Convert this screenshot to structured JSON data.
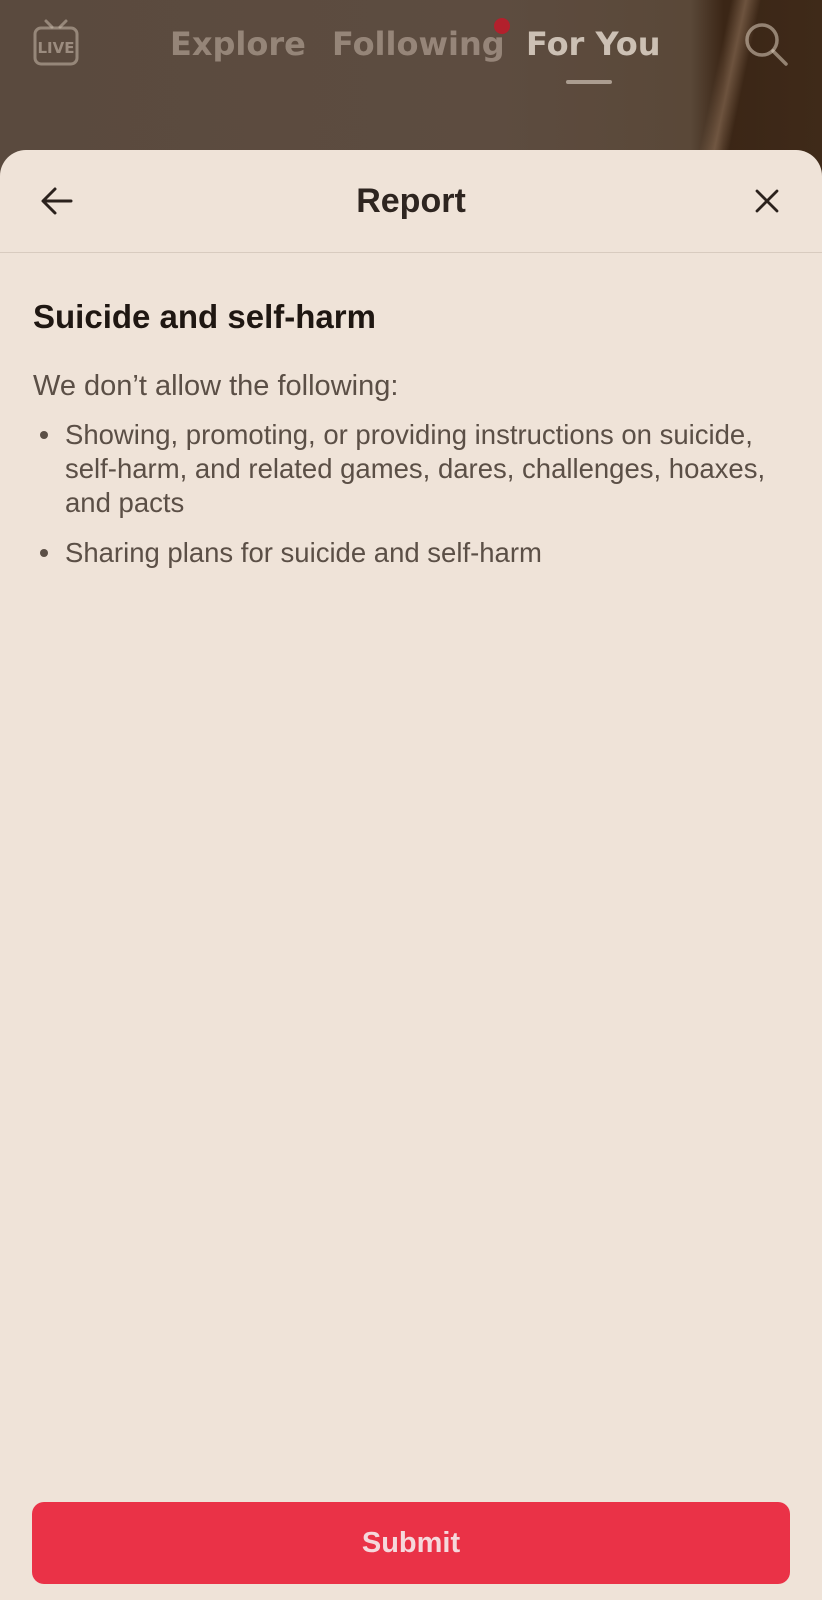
{
  "top_nav": {
    "live_label": "LIVE",
    "tabs": [
      {
        "label": "Explore",
        "active": false
      },
      {
        "label": "Following",
        "active": false,
        "has_notification_dot": true
      },
      {
        "label": "For You",
        "active": true
      }
    ],
    "icons": {
      "live": "live-tv-icon",
      "search": "search-icon"
    }
  },
  "report_sheet": {
    "title": "Report",
    "back_icon": "arrow-left-icon",
    "close_icon": "close-icon",
    "section_title": "Suicide and self-harm",
    "intro": "We don’t allow the following:",
    "rules": [
      "Showing, promoting, or providing instructions on suicide, self-harm, and related games, dares, challenges, hoaxes, and pacts",
      "Sharing plans for suicide and self-harm"
    ],
    "submit_label": "Submit"
  },
  "colors": {
    "sheet_background": "#efe3d8",
    "submit_button": "#ea3247",
    "notification_dot": "#b3202c",
    "title_text": "#2e2520"
  }
}
